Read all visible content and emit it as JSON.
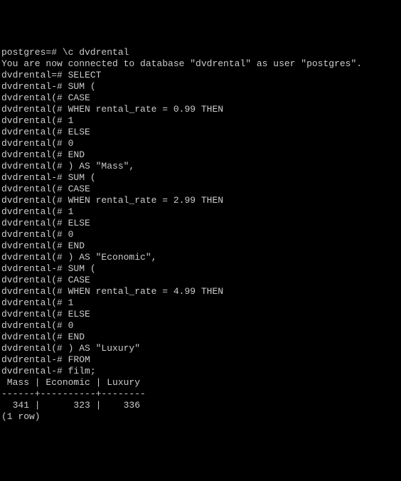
{
  "lines": [
    "postgres=# \\c dvdrental",
    "You are now connected to database \"dvdrental\" as user \"postgres\".",
    "dvdrental=# SELECT",
    "dvdrental-# SUM (",
    "dvdrental(# CASE",
    "dvdrental(# WHEN rental_rate = 0.99 THEN",
    "dvdrental(# 1",
    "dvdrental(# ELSE",
    "dvdrental(# 0",
    "dvdrental(# END",
    "dvdrental(# ) AS \"Mass\",",
    "dvdrental-# SUM (",
    "dvdrental(# CASE",
    "dvdrental(# WHEN rental_rate = 2.99 THEN",
    "dvdrental(# 1",
    "dvdrental(# ELSE",
    "dvdrental(# 0",
    "dvdrental(# END",
    "dvdrental(# ) AS \"Economic\",",
    "dvdrental-# SUM (",
    "dvdrental(# CASE",
    "dvdrental(# WHEN rental_rate = 4.99 THEN",
    "dvdrental(# 1",
    "dvdrental(# ELSE",
    "dvdrental(# 0",
    "dvdrental(# END",
    "dvdrental(# ) AS \"Luxury\"",
    "dvdrental-# FROM",
    "dvdrental-# film;",
    " Mass | Economic | Luxury",
    "------+----------+--------",
    "  341 |      323 |    336",
    "(1 row)"
  ]
}
